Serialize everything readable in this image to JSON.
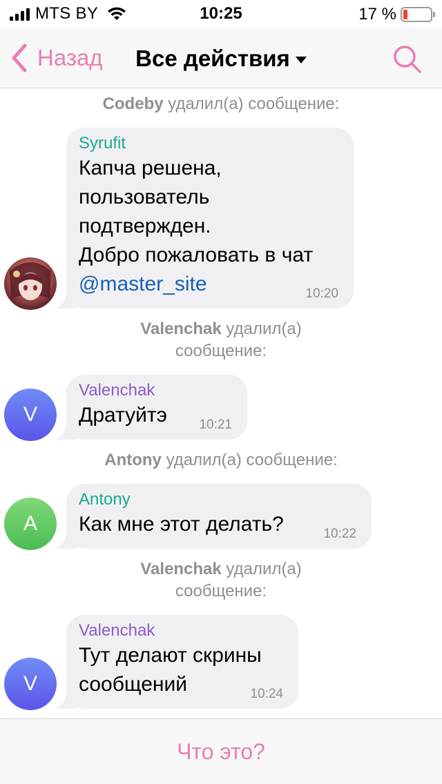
{
  "status": {
    "carrier": "MTS BY",
    "time": "10:25",
    "battery_pct": "17 %",
    "icons": [
      "signal-icon",
      "wifi-icon",
      "battery-icon"
    ]
  },
  "nav": {
    "back_label": "Назад",
    "title": "Все действия",
    "search_icon": "search-icon"
  },
  "events": [
    {
      "actor": "Codeby",
      "action": "удалил(а) сообщение:"
    },
    {
      "actor": "Valenchak",
      "action": "удалил(а)",
      "action2": "сообщение:"
    },
    {
      "actor": "Antony",
      "action": "удалил(а) сообщение:"
    },
    {
      "actor": "Valenchak",
      "action": "удалил(а)",
      "action2": "сообщение:"
    }
  ],
  "messages": [
    {
      "sender": "Syrufit",
      "lines": [
        "Капча решена,",
        "пользователь",
        "подтвержден.",
        "Добро пожаловать в чат"
      ],
      "mention": "@master_site",
      "time": "10:20"
    },
    {
      "sender": "Valenchak",
      "avatar_letter": "V",
      "text": "Дратуйтэ",
      "time": "10:21"
    },
    {
      "sender": "Antony",
      "avatar_letter": "A",
      "text": "Как мне этот делать?",
      "time": "10:22"
    },
    {
      "sender": "Valenchak",
      "avatar_letter": "V",
      "lines": [
        "Тут делают скрины",
        "сообщений"
      ],
      "time": "10:24"
    }
  ],
  "bottom": {
    "button_label": "Что это?"
  },
  "colors": {
    "accent": "#e87fb0",
    "syrufit": "#1aa98c",
    "valenchak": "#8a5cc9",
    "antony": "#1aa98c",
    "mention": "#1a5fb4",
    "bubble": "#f0f0f3"
  }
}
